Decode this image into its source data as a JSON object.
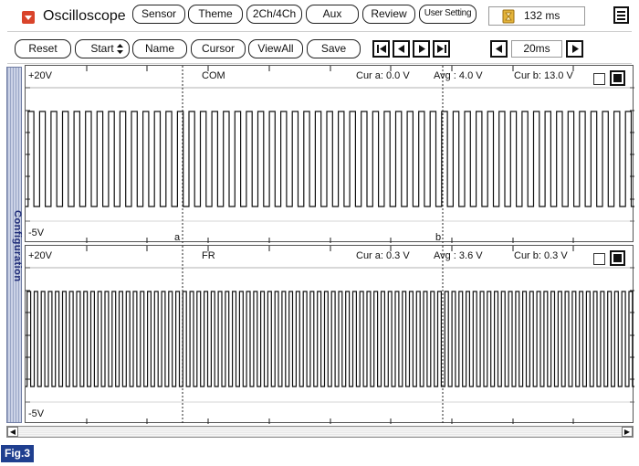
{
  "app": {
    "title": "Oscilloscope",
    "top_buttons": [
      "Sensor",
      "Theme",
      "2Ch/4Ch",
      "Aux",
      "Review",
      "User Setting"
    ],
    "time_readout": "132 ms"
  },
  "toolbar": {
    "reset": "Reset",
    "start": "Start",
    "name": "Name",
    "cursor": "Cursor",
    "viewall": "ViewAll",
    "save": "Save",
    "timebase": "20ms"
  },
  "sidebar": {
    "label": "Configuration"
  },
  "channels": [
    {
      "name": "COM",
      "top_label": "+20V",
      "bottom_label": "-5V",
      "cur_a": "Cur a: 0.0 V",
      "avg": "Avg  : 4.0 V",
      "cur_b": "Cur b: 13.0 V",
      "marker_a": "a",
      "marker_b": "b",
      "pulses_per_frame": 53
    },
    {
      "name": "FR",
      "top_label": "+20V",
      "bottom_label": "-5V",
      "cur_a": "Cur a: 0.3 V",
      "avg": "Avg  : 3.6 V",
      "cur_b": "Cur b: 0.3 V",
      "pulses_per_frame": 86
    }
  ],
  "figure_label": "Fig.3"
}
